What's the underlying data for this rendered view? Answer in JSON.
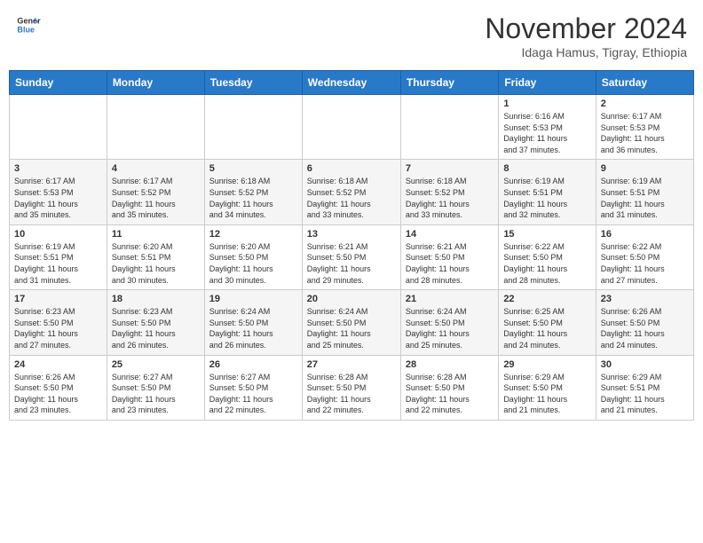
{
  "header": {
    "logo_line1": "General",
    "logo_line2": "Blue",
    "month": "November 2024",
    "location": "Idaga Hamus, Tigray, Ethiopia"
  },
  "weekdays": [
    "Sunday",
    "Monday",
    "Tuesday",
    "Wednesday",
    "Thursday",
    "Friday",
    "Saturday"
  ],
  "weeks": [
    [
      {
        "day": "",
        "info": ""
      },
      {
        "day": "",
        "info": ""
      },
      {
        "day": "",
        "info": ""
      },
      {
        "day": "",
        "info": ""
      },
      {
        "day": "",
        "info": ""
      },
      {
        "day": "1",
        "info": "Sunrise: 6:16 AM\nSunset: 5:53 PM\nDaylight: 11 hours\nand 37 minutes."
      },
      {
        "day": "2",
        "info": "Sunrise: 6:17 AM\nSunset: 5:53 PM\nDaylight: 11 hours\nand 36 minutes."
      }
    ],
    [
      {
        "day": "3",
        "info": "Sunrise: 6:17 AM\nSunset: 5:53 PM\nDaylight: 11 hours\nand 35 minutes."
      },
      {
        "day": "4",
        "info": "Sunrise: 6:17 AM\nSunset: 5:52 PM\nDaylight: 11 hours\nand 35 minutes."
      },
      {
        "day": "5",
        "info": "Sunrise: 6:18 AM\nSunset: 5:52 PM\nDaylight: 11 hours\nand 34 minutes."
      },
      {
        "day": "6",
        "info": "Sunrise: 6:18 AM\nSunset: 5:52 PM\nDaylight: 11 hours\nand 33 minutes."
      },
      {
        "day": "7",
        "info": "Sunrise: 6:18 AM\nSunset: 5:52 PM\nDaylight: 11 hours\nand 33 minutes."
      },
      {
        "day": "8",
        "info": "Sunrise: 6:19 AM\nSunset: 5:51 PM\nDaylight: 11 hours\nand 32 minutes."
      },
      {
        "day": "9",
        "info": "Sunrise: 6:19 AM\nSunset: 5:51 PM\nDaylight: 11 hours\nand 31 minutes."
      }
    ],
    [
      {
        "day": "10",
        "info": "Sunrise: 6:19 AM\nSunset: 5:51 PM\nDaylight: 11 hours\nand 31 minutes."
      },
      {
        "day": "11",
        "info": "Sunrise: 6:20 AM\nSunset: 5:51 PM\nDaylight: 11 hours\nand 30 minutes."
      },
      {
        "day": "12",
        "info": "Sunrise: 6:20 AM\nSunset: 5:50 PM\nDaylight: 11 hours\nand 30 minutes."
      },
      {
        "day": "13",
        "info": "Sunrise: 6:21 AM\nSunset: 5:50 PM\nDaylight: 11 hours\nand 29 minutes."
      },
      {
        "day": "14",
        "info": "Sunrise: 6:21 AM\nSunset: 5:50 PM\nDaylight: 11 hours\nand 28 minutes."
      },
      {
        "day": "15",
        "info": "Sunrise: 6:22 AM\nSunset: 5:50 PM\nDaylight: 11 hours\nand 28 minutes."
      },
      {
        "day": "16",
        "info": "Sunrise: 6:22 AM\nSunset: 5:50 PM\nDaylight: 11 hours\nand 27 minutes."
      }
    ],
    [
      {
        "day": "17",
        "info": "Sunrise: 6:23 AM\nSunset: 5:50 PM\nDaylight: 11 hours\nand 27 minutes."
      },
      {
        "day": "18",
        "info": "Sunrise: 6:23 AM\nSunset: 5:50 PM\nDaylight: 11 hours\nand 26 minutes."
      },
      {
        "day": "19",
        "info": "Sunrise: 6:24 AM\nSunset: 5:50 PM\nDaylight: 11 hours\nand 26 minutes."
      },
      {
        "day": "20",
        "info": "Sunrise: 6:24 AM\nSunset: 5:50 PM\nDaylight: 11 hours\nand 25 minutes."
      },
      {
        "day": "21",
        "info": "Sunrise: 6:24 AM\nSunset: 5:50 PM\nDaylight: 11 hours\nand 25 minutes."
      },
      {
        "day": "22",
        "info": "Sunrise: 6:25 AM\nSunset: 5:50 PM\nDaylight: 11 hours\nand 24 minutes."
      },
      {
        "day": "23",
        "info": "Sunrise: 6:26 AM\nSunset: 5:50 PM\nDaylight: 11 hours\nand 24 minutes."
      }
    ],
    [
      {
        "day": "24",
        "info": "Sunrise: 6:26 AM\nSunset: 5:50 PM\nDaylight: 11 hours\nand 23 minutes."
      },
      {
        "day": "25",
        "info": "Sunrise: 6:27 AM\nSunset: 5:50 PM\nDaylight: 11 hours\nand 23 minutes."
      },
      {
        "day": "26",
        "info": "Sunrise: 6:27 AM\nSunset: 5:50 PM\nDaylight: 11 hours\nand 22 minutes."
      },
      {
        "day": "27",
        "info": "Sunrise: 6:28 AM\nSunset: 5:50 PM\nDaylight: 11 hours\nand 22 minutes."
      },
      {
        "day": "28",
        "info": "Sunrise: 6:28 AM\nSunset: 5:50 PM\nDaylight: 11 hours\nand 22 minutes."
      },
      {
        "day": "29",
        "info": "Sunrise: 6:29 AM\nSunset: 5:50 PM\nDaylight: 11 hours\nand 21 minutes."
      },
      {
        "day": "30",
        "info": "Sunrise: 6:29 AM\nSunset: 5:51 PM\nDaylight: 11 hours\nand 21 minutes."
      }
    ]
  ]
}
